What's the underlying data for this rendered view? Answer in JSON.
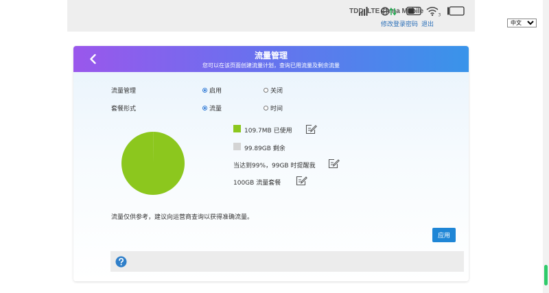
{
  "statusbar": {
    "network_type": "TDD_LTE",
    "carrier": "China Mobile",
    "icons": [
      "signal-bars-icon",
      "globe-data-icon",
      "sim-card-icon",
      "wifi-icon",
      "battery-icon"
    ],
    "wifi_clients": "3",
    "change_password_link": "修改登录密码",
    "logout_link": "退出",
    "language_selected": "中文"
  },
  "page": {
    "title": "流量管理",
    "subtitle": "您可以在该页面创建流量计划，查询已用流量及剩余流量"
  },
  "form": {
    "traffic_mgmt": {
      "label": "流量管理",
      "options": [
        "启用",
        "关闭"
      ],
      "selected": "启用"
    },
    "package_type": {
      "label": "套餐形式",
      "options": [
        "流量",
        "时间"
      ],
      "selected": "流量"
    }
  },
  "usage": {
    "used_text": "109.7MB 已使用",
    "remaining_text": "99.89GB 剩余",
    "alert_text": "当达到99%，99GB 时提醒我",
    "package_text": "100GB 流量套餐",
    "colors": {
      "used": "#8cc71e",
      "remaining": "#d4d4d4"
    }
  },
  "chart_data": {
    "type": "pie",
    "series": [
      {
        "name": "已使用",
        "value": 109.7,
        "unit": "MB",
        "color": "#8cc71e"
      },
      {
        "name": "剩余",
        "value": 102287.4,
        "unit": "MB",
        "color": "#d4d4d4"
      }
    ]
  },
  "notice": "流量仅供参考，建议向运营商查询以获得准确流量。",
  "apply_button": "应用"
}
